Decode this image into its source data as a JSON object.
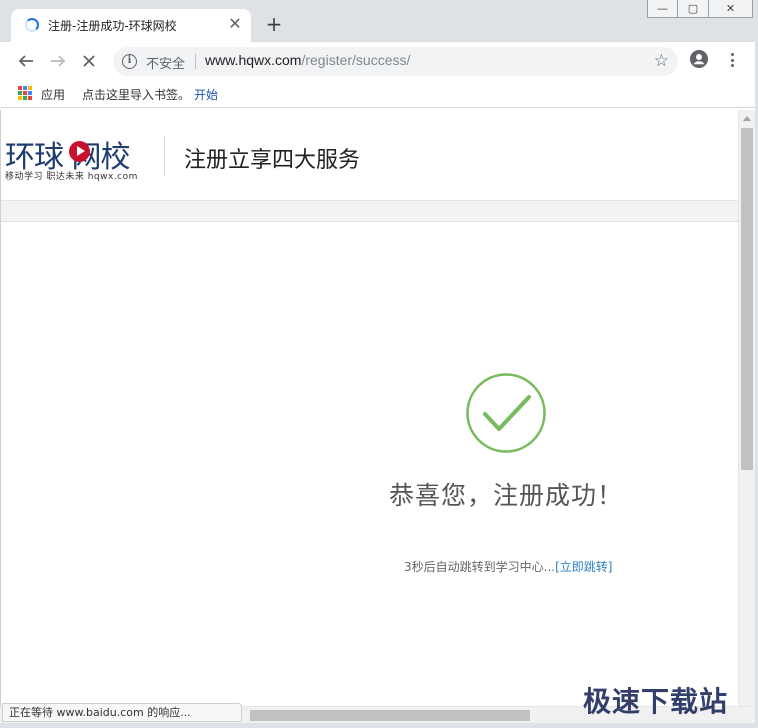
{
  "browser": {
    "tab": {
      "title": "注册-注册成功-环球网校",
      "close_glyph": "✕"
    },
    "new_tab_glyph": "+",
    "window_controls": {
      "minimize": "—",
      "maximize": "▢",
      "close": "✕"
    },
    "omnibox": {
      "security_label": "不安全",
      "url_host": "www.hqwx.com",
      "url_path": "/register/success/",
      "star_glyph": "☆"
    },
    "bookmarks": {
      "apps_label": "应用",
      "import_hint": "点击这里导入书签。",
      "import_link": "开始",
      "apps_colors": [
        "#ea4335",
        "#4285f4",
        "#fbbc05",
        "#34a853",
        "#ea4335",
        "#4285f4",
        "#fbbc05",
        "#34a853",
        "#ea4335"
      ]
    },
    "status_text": "正在等待 www.baidu.com 的响应..."
  },
  "site": {
    "logo": {
      "main": "环球 网校",
      "sub": "移动学习 职达未来 hqwx.com",
      "brand_color": "#1e3d6e",
      "accent_color": "#c8102e"
    },
    "header_title": "注册立享四大服务"
  },
  "success": {
    "icon": "check-circle-icon",
    "color": "#76bb5c",
    "title": "恭喜您，注册成功！",
    "redirect_text": "3秒后自动跳转到学习中心...",
    "redirect_link": "[立即跳转]"
  },
  "watermark": "极速下载站"
}
